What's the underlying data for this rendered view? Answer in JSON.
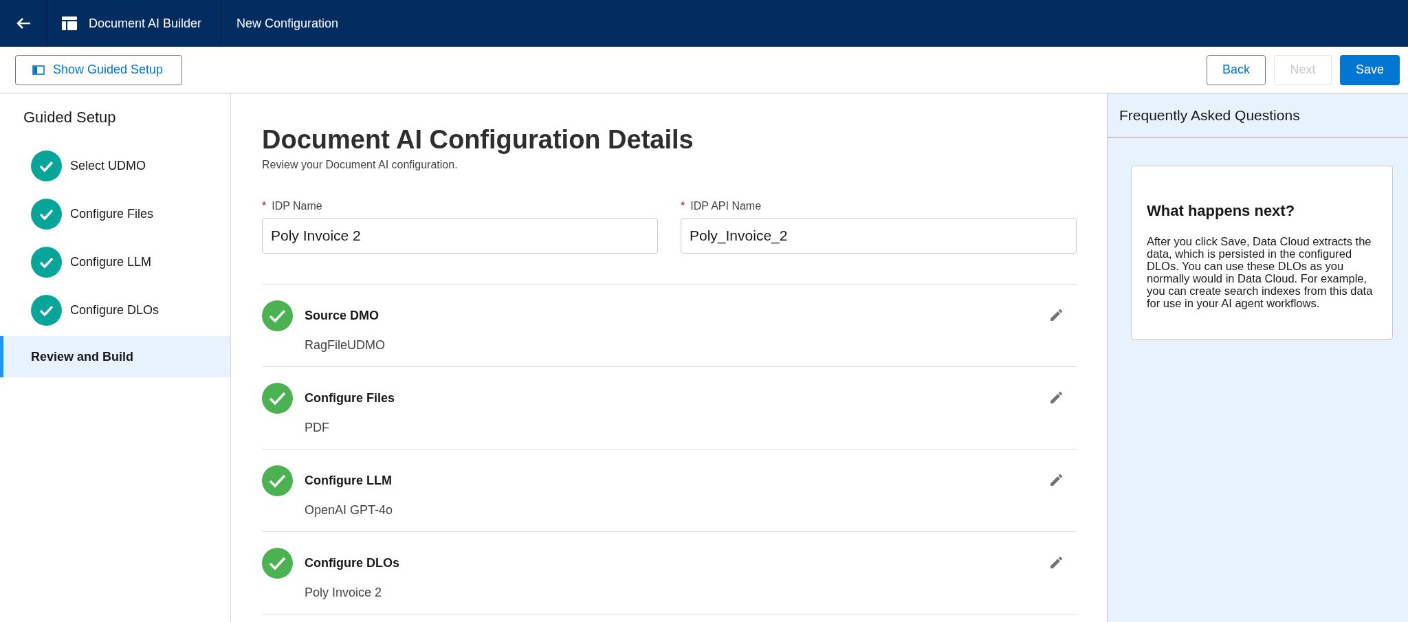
{
  "header": {
    "title": "Document AI Builder",
    "page": "New Configuration"
  },
  "toolbar": {
    "guide_button": "Show Guided Setup",
    "buttons": [
      {
        "label": "Back",
        "kind": "neutral",
        "disabled": false
      },
      {
        "label": "Next",
        "kind": "neutral",
        "disabled": true
      },
      {
        "label": "Save",
        "kind": "brand",
        "disabled": false
      }
    ]
  },
  "sidebar": {
    "title": "Guided Setup",
    "items": [
      {
        "label": "Select UDMO",
        "completed": true,
        "selected": false
      },
      {
        "label": "Configure Files",
        "completed": true,
        "selected": false
      },
      {
        "label": "Configure LLM",
        "completed": true,
        "selected": false
      },
      {
        "label": "Configure DLOs",
        "completed": true,
        "selected": false
      },
      {
        "label": "Review and Build",
        "completed": false,
        "selected": true
      }
    ]
  },
  "main": {
    "title": "Document AI Configuration Details",
    "subtitle": "Review your Document AI configuration.",
    "fields": [
      {
        "label": "IDP Name",
        "required_marker": "*",
        "value": "Poly Invoice 2"
      },
      {
        "label": "IDP API Name",
        "required_marker": "*",
        "value": "Poly_Invoice_2"
      }
    ],
    "sections": [
      {
        "title": "Source DMO",
        "value": "RagFileUDMO",
        "completed": true
      },
      {
        "title": "Configure Files",
        "value": "PDF",
        "completed": true
      },
      {
        "title": "Configure LLM",
        "value": "OpenAI GPT-4o",
        "completed": true
      },
      {
        "title": "Configure DLOs",
        "value": "Poly Invoice 2",
        "completed": true
      }
    ]
  },
  "faq": {
    "title": "Frequently Asked Questions",
    "card_title": "What happens next?",
    "card_text": "After you click Save, Data Cloud extracts the data, which is persisted in the configured DLOs. You can use these DLOs as you normally would in Data Cloud. For example, you can create search indexes from this data for use in your AI agent workflows."
  }
}
